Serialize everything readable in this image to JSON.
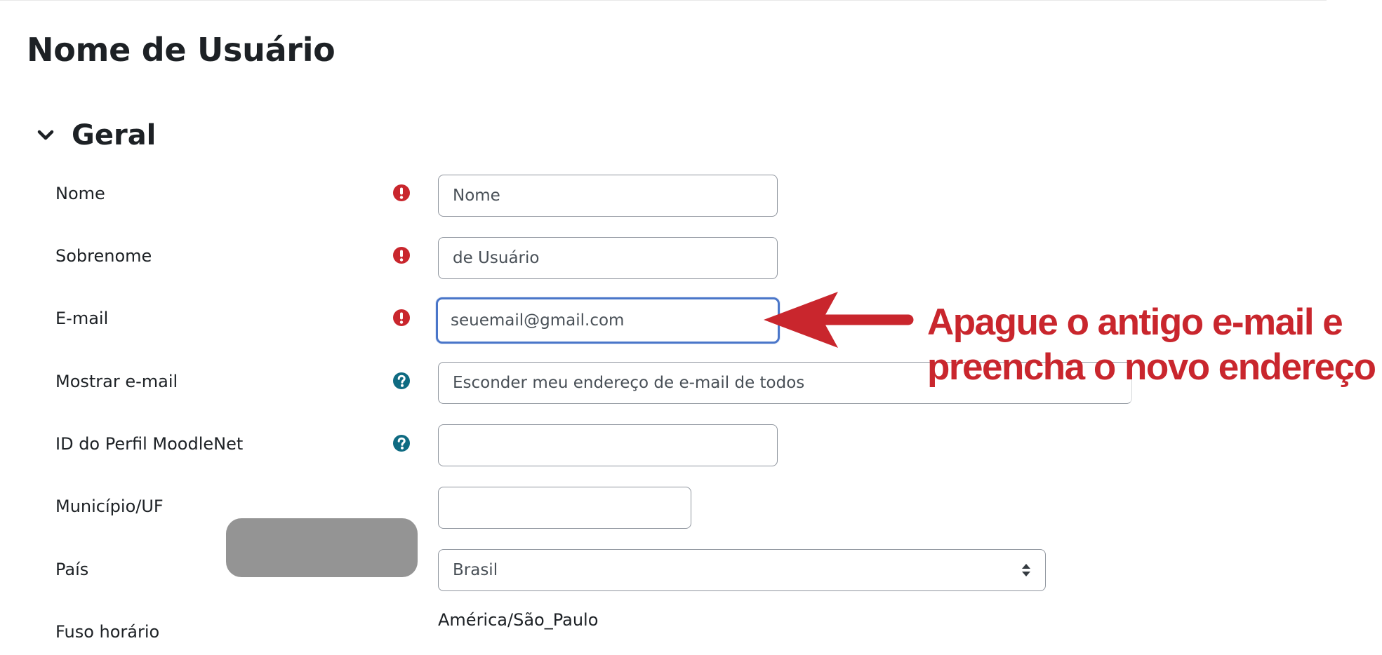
{
  "page": {
    "title": "Nome de Usuário"
  },
  "section": {
    "title": "Geral"
  },
  "form": {
    "nome": {
      "label": "Nome",
      "placeholder": "Nome",
      "value": ""
    },
    "sobrenome": {
      "label": "Sobrenome",
      "value": "de Usuário"
    },
    "email": {
      "label": "E-mail",
      "value": "seuemail@gmail.com"
    },
    "mostrar_email": {
      "label": "Mostrar e-mail",
      "selected": "Esconder meu endereço de e-mail de todos"
    },
    "moodlenet": {
      "label": "ID do Perfil MoodleNet",
      "value": ""
    },
    "municipio": {
      "label": "Município/UF",
      "value": ""
    },
    "pais": {
      "label": "País",
      "selected": "Brasil"
    },
    "fuso": {
      "label": "Fuso horário",
      "value": "América/São_Paulo"
    }
  },
  "annotation": {
    "line1": "Apague o antigo e-mail e",
    "line2": "preencha o novo endereço",
    "color": "#c9262d"
  },
  "colors": {
    "required": "#c9262d",
    "help": "#0f6b82",
    "focus": "#4a76c9",
    "redaction": "#949494"
  },
  "icons": {
    "required": "exclamation-circle-icon",
    "help": "question-circle-icon",
    "section": "chevron-down-icon"
  }
}
